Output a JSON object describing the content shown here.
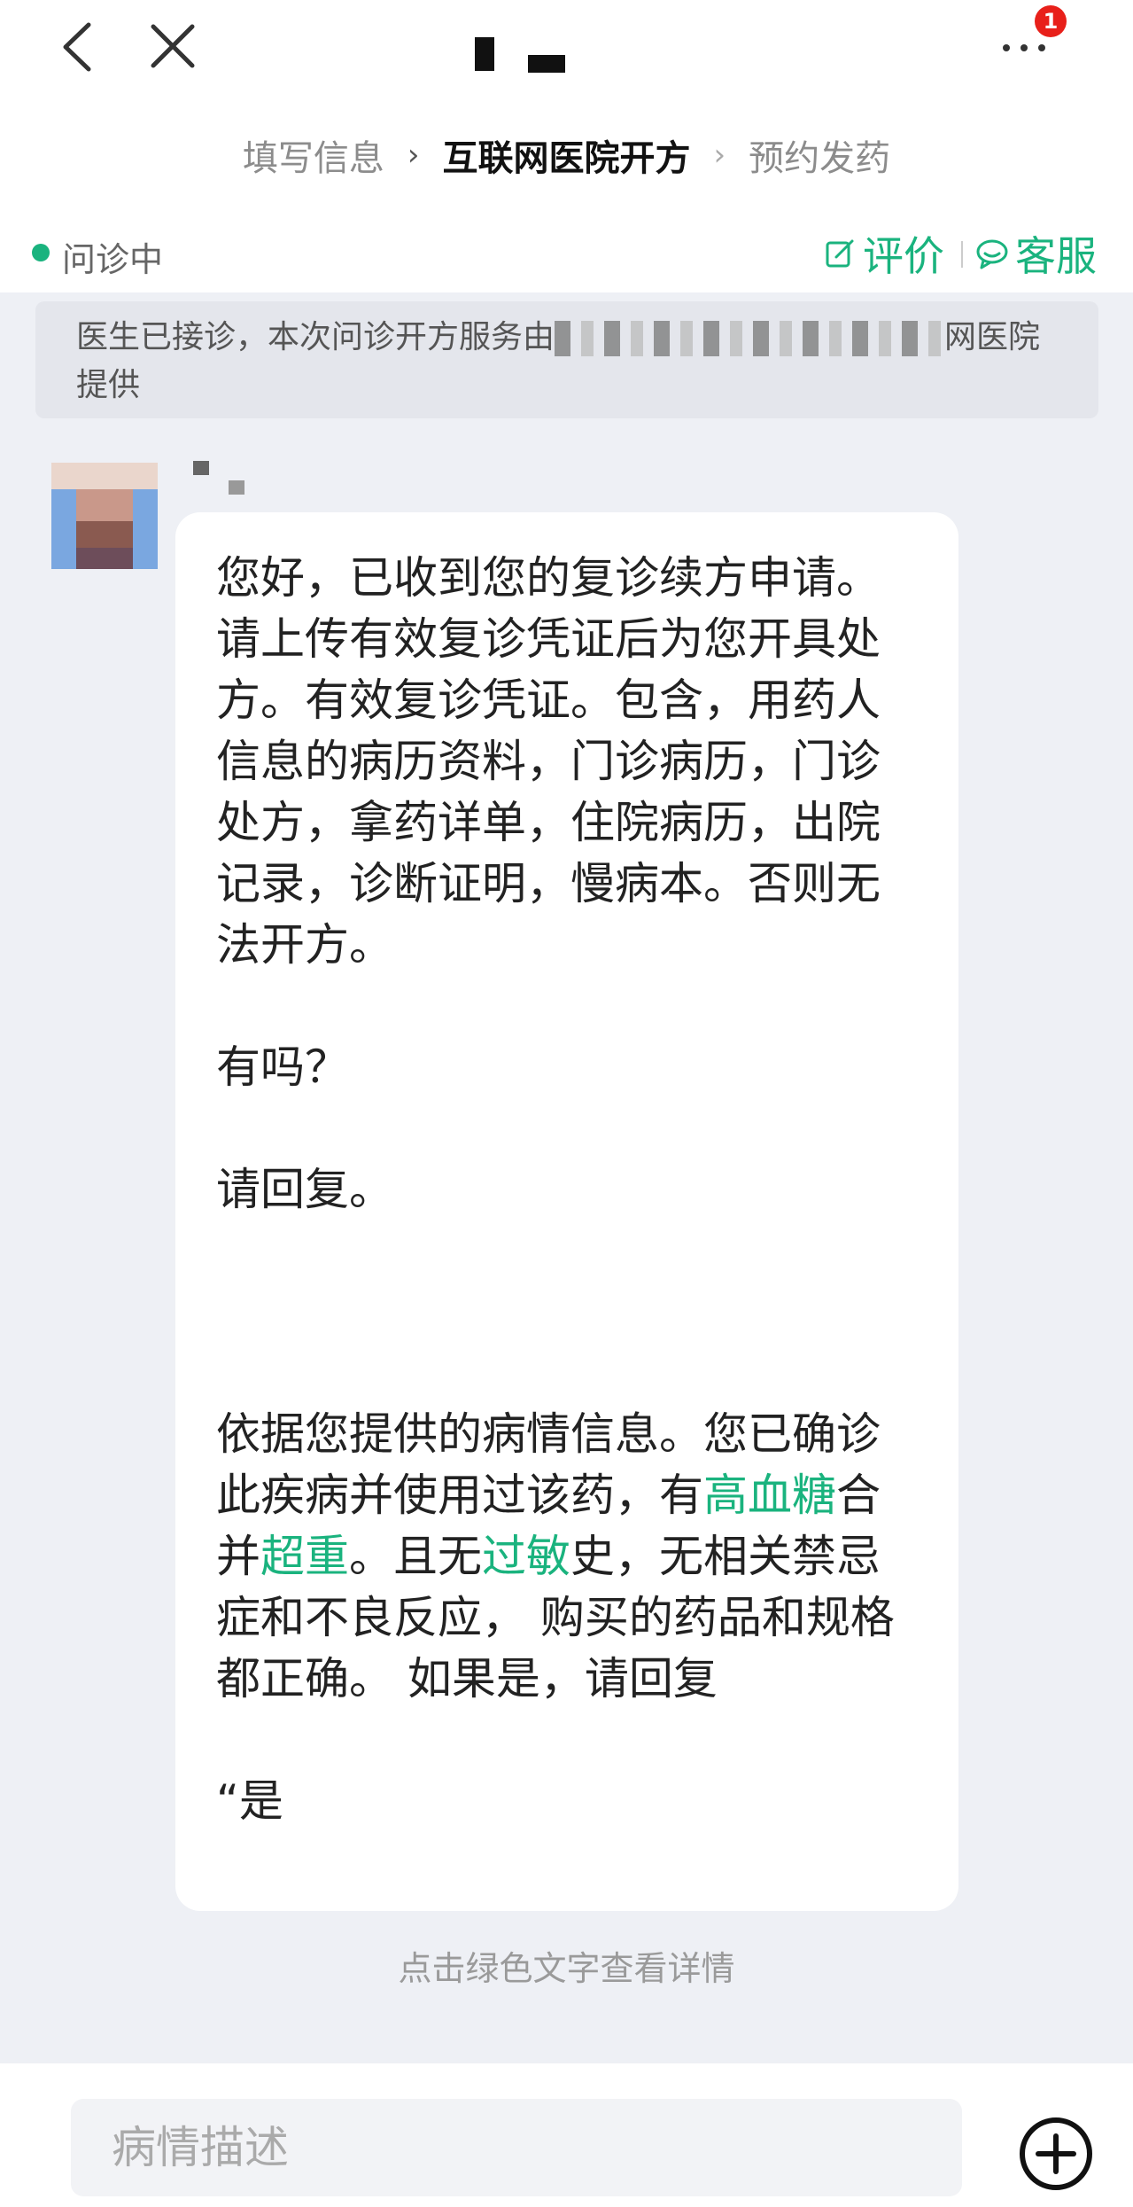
{
  "header": {
    "badge_count": "1",
    "steps": [
      "填写信息",
      "互联网医院开方",
      "预约发药"
    ],
    "active_step": 1
  },
  "status": {
    "text": "问诊中",
    "rate_label": "评价",
    "service_label": "客服"
  },
  "notice": {
    "text_before": "医生已接诊，本次问诊开方服务由",
    "text_after": "网医院提供"
  },
  "message": {
    "para1": "您好，已收到您的复诊续方申请。请上传有效复诊凭证后为您开具处方。有效复诊凭证。包含，用药人信息的病历资料，门诊病历，门诊处方，拿药详单，住院病历，出院记录，诊断证明，慢病本。否则无法开方。",
    "para2": "有吗？",
    "para3": "请回复。",
    "para4_a": "依据您提供的病情信息。您已确诊此疾病并使用过该药，有",
    "para4_link1": "高血糖",
    "para4_b": "合并",
    "para4_link2": "超重",
    "para4_c": "。且无",
    "para4_link3": "过敏",
    "para4_d": "史，无相关禁忌症和不良反应， 购买的药品和规格都正确。 如果是，请回复",
    "para5": "“是"
  },
  "hint": "点击绿色文字查看详情",
  "input": {
    "placeholder": "病情描述",
    "value": ""
  },
  "colors": {
    "accent": "#1ab37e",
    "badge": "#e8201a",
    "background": "#eef0f5"
  },
  "icons": [
    "back-icon",
    "close-icon",
    "more-icon",
    "edit-icon",
    "chat-bubble-icon",
    "plus-circle-icon"
  ]
}
